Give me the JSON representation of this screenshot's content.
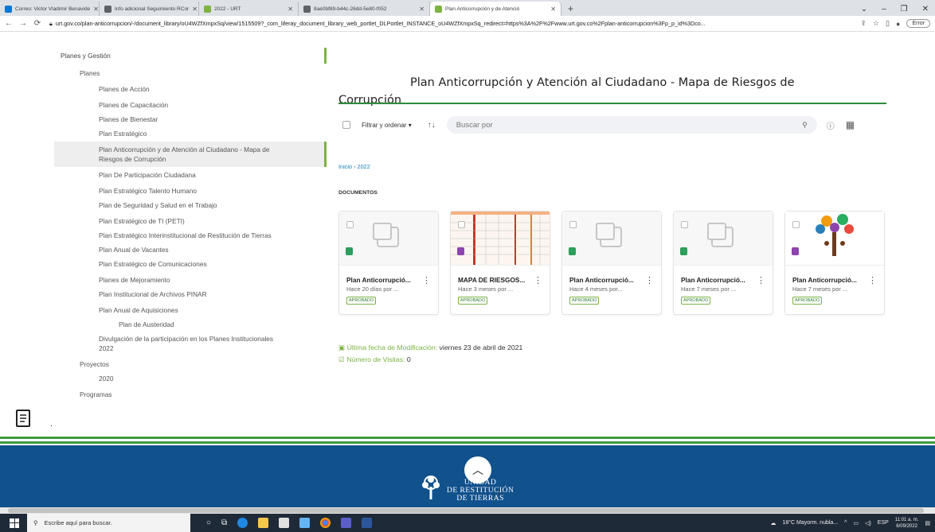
{
  "browser": {
    "tabs": [
      {
        "label": "Correo: Victor Vladimir Benavide",
        "color": "#0078d4",
        "active": false
      },
      {
        "label": "Info adicional Seguimiento RCor",
        "color": "#5f6368",
        "active": false
      },
      {
        "label": "2022 - URT",
        "color": "#7cb342",
        "active": false
      },
      {
        "label": "8ae0bf89-b44c-26dd-5e80-f052",
        "color": "#5f6368",
        "active": false
      },
      {
        "label": "Plan Anticorrupción y de Atenció",
        "color": "#7cb342",
        "active": true
      }
    ],
    "new_tab": "+",
    "url": "urt.gov.co/plan-anticorrupcion/-/document_library/oU4WZfXmpxSq/view/1515509?_com_liferay_document_library_web_portlet_DLPortlet_INSTANCE_oU4WZfXmpxSq_redirect=https%3A%2F%2Fwww.urt.gov.co%2Fplan-anticorrupcion%3Fp_p_id%3Dco...",
    "error_label": "Error"
  },
  "sidebar": {
    "top": "Planes y Gestión",
    "items": [
      {
        "label": "Planes",
        "level": 1
      },
      {
        "label": "Planes de Acción",
        "level": 2
      },
      {
        "label": "Planes de Capacitación",
        "level": 2
      },
      {
        "label": "Planes de Bienestar",
        "level": 2
      },
      {
        "label": "Plan Estratégico",
        "level": 2
      },
      {
        "label": "Plan De Participación Ciudadana",
        "level": 2
      },
      {
        "label": "Plan Estratégico Talento Humano",
        "level": 2
      },
      {
        "label": "Plan de Seguridad y Salud en el Trabajo",
        "level": 2
      },
      {
        "label": "Plan Estratégico de TI (PETI)",
        "level": 2
      },
      {
        "label": "Plan Estratégico Interinstitucional de Restitución de Tierras",
        "level": 2
      },
      {
        "label": "Plan Anual de Vacantes",
        "level": 2
      },
      {
        "label": "Plan Estratégico de Comunicaciones",
        "level": 2
      },
      {
        "label": "Planes de Mejoramiento",
        "level": 2
      },
      {
        "label": "Plan Institucional de Archivos PINAR",
        "level": 2
      },
      {
        "label": "Plan Anual de Aquisiciones",
        "level": 2
      },
      {
        "label": "Plan de Austeridad",
        "level": 3
      },
      {
        "label": "Divulgación de la participación en los Planes Institucionales",
        "level": 2
      },
      {
        "label": "2022",
        "level": 2
      },
      {
        "label": "Proyectos",
        "level": 1
      },
      {
        "label": "2020",
        "level": 2
      },
      {
        "label": "Programas",
        "level": 1
      }
    ],
    "active_line1": "Plan Anticorrupción y de Atención al Ciudadano - Mapa de",
    "active_line2": "Riesgos de Corrupción"
  },
  "main": {
    "title_line1": "Plan Anticorrupción y Atención al Ciudadano - Mapa de Riesgos de",
    "title_line2": "Corrupción",
    "filter_label": "Filtrar y ordenar",
    "search_placeholder": "Buscar por",
    "breadcrumb": "Inicio › 2022",
    "section_label": "DOCUMENTOS",
    "cards": [
      {
        "title": "Plan Anticorrupció...",
        "subtitle": "Hace 20 días por ...",
        "status": "APROBADO",
        "badge_color": "#2e9e5b",
        "thumb": "placeholder"
      },
      {
        "title": "MAPA DE RIESGOS...",
        "subtitle": "Hace 3 meses por ...",
        "status": "APROBADO",
        "badge_color": "#8e44ad",
        "thumb": "spreadsheet"
      },
      {
        "title": "Plan Anticorrupció...",
        "subtitle": "Hace 4 meses por...",
        "status": "APROBADO",
        "badge_color": "#2e9e5b",
        "thumb": "placeholder"
      },
      {
        "title": "Plan Anticorrupció...",
        "subtitle": "Hace 7 meses por ...",
        "status": "APROBADO",
        "badge_color": "#2e9e5b",
        "thumb": "placeholder"
      },
      {
        "title": "Plan Anticorrupció...",
        "subtitle": "Hace 7 meses por ...",
        "status": "APROBADO",
        "badge_color": "#8e44ad",
        "thumb": "unidad"
      }
    ],
    "last_modified_key": "Última fecha de Modificación:",
    "last_modified_value": "viernes 23 de abril de 2021",
    "visits_key": "Número de Visitas:",
    "visits_value": "0"
  },
  "footer": {
    "logo_line1": "UNIDAD",
    "logo_line2": "DE RESTITUCIÓN",
    "logo_line3": "DE TIERRAS"
  },
  "taskbar": {
    "search_placeholder": "Escribe aquí para buscar.",
    "weather": "18°C Mayorm. nubla...",
    "language": "ESP",
    "time": "11:01 a. m.",
    "date": "6/09/2022"
  },
  "colors": {
    "accent_green": "#7cb342",
    "footer_blue": "#11518c",
    "link_blue": "#1a7fb5"
  }
}
